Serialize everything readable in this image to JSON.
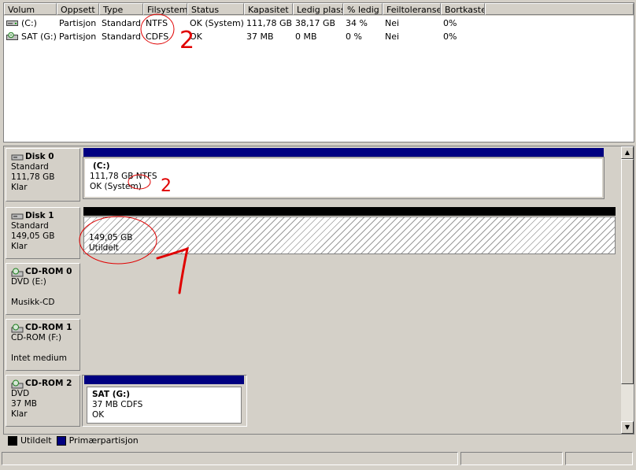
{
  "volume_list": {
    "columns": [
      "Volum",
      "Oppsett",
      "Type",
      "Filsystem",
      "Status",
      "Kapasitet",
      "Ledig plass",
      "% ledig",
      "Feiltoleranse",
      "Bortkastet"
    ],
    "rows": [
      {
        "icon": "drive-icon",
        "cells": [
          "(C:)",
          "Partisjon",
          "Standard",
          "NTFS",
          "OK (System)",
          "111,78 GB",
          "38,17 GB",
          "34 %",
          "Nei",
          "0%"
        ]
      },
      {
        "icon": "cd-drive-icon",
        "cells": [
          "SAT (G:)",
          "Partisjon",
          "Standard",
          "CDFS",
          "OK",
          "37 MB",
          "0 MB",
          "0 %",
          "Nei",
          "0%"
        ]
      }
    ]
  },
  "disks": [
    {
      "name": "Disk 0",
      "type": "Standard",
      "size": "111,78 GB",
      "status": "Klar",
      "partition": {
        "title": "(C:)",
        "line1": "111,78 GB NTFS",
        "line2": "OK (System)"
      }
    },
    {
      "name": "Disk 1",
      "type": "Standard",
      "size": "149,05 GB",
      "status": "Klar",
      "partition": {
        "line1": "149,05 GB",
        "line2": "Utildelt"
      }
    },
    {
      "name": "CD-ROM 0",
      "type": "DVD (E:)",
      "status": "Musikk-CD"
    },
    {
      "name": "CD-ROM 1",
      "type": "CD-ROM (F:)",
      "status": "Intet medium"
    },
    {
      "name": "CD-ROM 2",
      "type": "DVD",
      "size": "37 MB",
      "status": "Klar",
      "partition": {
        "title": "SAT  (G:)",
        "line1": "37 MB CDFS",
        "line2": "OK"
      }
    }
  ],
  "legend": {
    "unallocated": "Utildelt",
    "primary": "Primærpartisjon"
  },
  "colors": {
    "primary": "#000080",
    "unallocated": "#000000",
    "annotation": "#e00000",
    "window_bg": "#d4d0c8"
  },
  "annotations": {
    "mark_2": "2",
    "mark_1": "1"
  }
}
